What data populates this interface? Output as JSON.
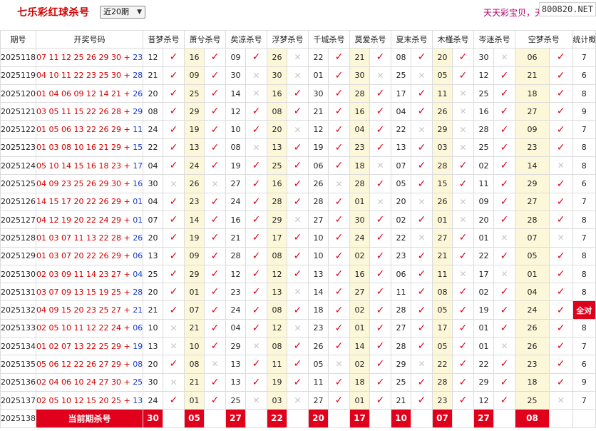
{
  "page_title": "七乐彩红球杀号",
  "period_select": {
    "value": "近20期",
    "arrow": "▼"
  },
  "slogan": "天天彩宝贝，天",
  "site_badge": "800820.NET",
  "headers": {
    "issue": "期号",
    "draw": "开奖号码",
    "experts": [
      "昔梦杀号",
      "萧兮杀号",
      "矣凉杀号",
      "浮梦杀号",
      "千城杀号",
      "莫爱杀号",
      "夏末杀号",
      "木槿杀号",
      "岑迷杀号",
      "空梦杀号"
    ],
    "stat": "统计概况"
  },
  "rows": [
    {
      "issue": "2025118",
      "draw": "07 11 12 25 26 29 30",
      "special": "23",
      "kills": [
        "12",
        "16",
        "09",
        "26",
        "22",
        "21",
        "08",
        "20",
        "30",
        "06"
      ],
      "hits": [
        true,
        true,
        true,
        false,
        true,
        true,
        true,
        true,
        false,
        true
      ],
      "stat": "7"
    },
    {
      "issue": "2025119",
      "draw": "04 10 11 22 23 25 30",
      "special": "28",
      "kills": [
        "21",
        "09",
        "30",
        "30",
        "01",
        "30",
        "25",
        "05",
        "12",
        "21"
      ],
      "hits": [
        true,
        true,
        false,
        false,
        true,
        false,
        false,
        true,
        true,
        true
      ],
      "stat": "6"
    },
    {
      "issue": "2025120",
      "draw": "01 04 06 09 12 14 21",
      "special": "26",
      "kills": [
        "20",
        "25",
        "14",
        "16",
        "30",
        "28",
        "17",
        "11",
        "25",
        "18"
      ],
      "hits": [
        true,
        true,
        false,
        true,
        true,
        true,
        true,
        false,
        true,
        true
      ],
      "stat": "8"
    },
    {
      "issue": "2025121",
      "draw": "03 05 11 15 22 26 28",
      "special": "29",
      "kills": [
        "08",
        "29",
        "12",
        "08",
        "21",
        "16",
        "04",
        "26",
        "16",
        "27"
      ],
      "hits": [
        true,
        true,
        true,
        true,
        true,
        true,
        true,
        false,
        true,
        true
      ],
      "stat": "9"
    },
    {
      "issue": "2025122",
      "draw": "01 05 06 13 22 26 29",
      "special": "11",
      "kills": [
        "24",
        "19",
        "10",
        "20",
        "12",
        "04",
        "22",
        "29",
        "28",
        "09"
      ],
      "hits": [
        true,
        true,
        true,
        false,
        true,
        true,
        false,
        false,
        true,
        true
      ],
      "stat": "7"
    },
    {
      "issue": "2025123",
      "draw": "01 03 08 10 16 21 29",
      "special": "15",
      "kills": [
        "22",
        "13",
        "08",
        "13",
        "19",
        "23",
        "13",
        "03",
        "25",
        "23"
      ],
      "hits": [
        true,
        true,
        false,
        true,
        true,
        true,
        true,
        false,
        true,
        true
      ],
      "stat": "8"
    },
    {
      "issue": "2025124",
      "draw": "05 10 14 15 16 18 23",
      "special": "17",
      "kills": [
        "04",
        "24",
        "19",
        "25",
        "06",
        "18",
        "07",
        "28",
        "02",
        "14"
      ],
      "hits": [
        true,
        true,
        true,
        true,
        true,
        false,
        true,
        true,
        true,
        false
      ],
      "stat": "8"
    },
    {
      "issue": "2025125",
      "draw": "04 09 23 25 26 29 30",
      "special": "16",
      "kills": [
        "30",
        "26",
        "27",
        "16",
        "26",
        "28",
        "05",
        "15",
        "11",
        "29"
      ],
      "hits": [
        false,
        false,
        true,
        true,
        false,
        true,
        true,
        true,
        true,
        true
      ],
      "stat": "6"
    },
    {
      "issue": "2025126",
      "draw": "14 15 17 20 22 26 29",
      "special": "01",
      "kills": [
        "04",
        "23",
        "24",
        "28",
        "28",
        "01",
        "20",
        "26",
        "09",
        "27"
      ],
      "hits": [
        true,
        true,
        true,
        true,
        true,
        false,
        false,
        false,
        true,
        true
      ],
      "stat": "7"
    },
    {
      "issue": "2025127",
      "draw": "04 12 19 20 22 24 29",
      "special": "01",
      "kills": [
        "07",
        "14",
        "16",
        "29",
        "27",
        "30",
        "02",
        "01",
        "20",
        "28"
      ],
      "hits": [
        true,
        true,
        true,
        false,
        true,
        true,
        true,
        false,
        true,
        true
      ],
      "stat": "8"
    },
    {
      "issue": "2025128",
      "draw": "01 03 07 11 13 22 28",
      "special": "26",
      "kills": [
        "20",
        "19",
        "21",
        "17",
        "10",
        "24",
        "22",
        "27",
        "01",
        "07"
      ],
      "hits": [
        true,
        true,
        true,
        true,
        true,
        true,
        false,
        true,
        false,
        false
      ],
      "stat": "7"
    },
    {
      "issue": "2025129",
      "draw": "01 03 07 20 22 26 29",
      "special": "06",
      "kills": [
        "13",
        "09",
        "28",
        "08",
        "10",
        "02",
        "23",
        "21",
        "22",
        "05"
      ],
      "hits": [
        true,
        true,
        true,
        true,
        true,
        true,
        true,
        true,
        true,
        true
      ],
      "stat": "8"
    },
    {
      "issue": "2025130",
      "draw": "02 03 09 11 14 23 27",
      "special": "04",
      "kills": [
        "25",
        "29",
        "12",
        "12",
        "13",
        "16",
        "06",
        "11",
        "17",
        "01"
      ],
      "hits": [
        true,
        true,
        true,
        true,
        true,
        true,
        true,
        false,
        false,
        true
      ],
      "stat": "8"
    },
    {
      "issue": "2025131",
      "draw": "03 07 09 13 15 19 25",
      "special": "28",
      "kills": [
        "20",
        "01",
        "23",
        "13",
        "14",
        "27",
        "11",
        "08",
        "02",
        "04"
      ],
      "hits": [
        true,
        true,
        true,
        false,
        true,
        true,
        true,
        true,
        true,
        true
      ],
      "stat": "8"
    },
    {
      "issue": "2025132",
      "draw": "04 09 15 20 23 25 27",
      "special": "21",
      "kills": [
        "21",
        "07",
        "24",
        "08",
        "18",
        "02",
        "28",
        "05",
        "19",
        "24"
      ],
      "hits": [
        true,
        true,
        true,
        true,
        true,
        true,
        true,
        true,
        true,
        true
      ],
      "stat": "全对",
      "stat_full": true
    },
    {
      "issue": "2025133",
      "draw": "02 05 10 11 12 22 24",
      "special": "06",
      "kills": [
        "10",
        "21",
        "04",
        "12",
        "23",
        "01",
        "27",
        "17",
        "01",
        "26"
      ],
      "hits": [
        false,
        true,
        true,
        false,
        true,
        true,
        true,
        true,
        true,
        true
      ],
      "stat": "8"
    },
    {
      "issue": "2025134",
      "draw": "01 02 07 13 22 25 29",
      "special": "19",
      "kills": [
        "13",
        "10",
        "29",
        "08",
        "26",
        "14",
        "28",
        "05",
        "01",
        "26"
      ],
      "hits": [
        false,
        true,
        false,
        true,
        true,
        true,
        true,
        true,
        false,
        true
      ],
      "stat": "7"
    },
    {
      "issue": "2025135",
      "draw": "05 06 12 22 26 27 29",
      "special": "08",
      "kills": [
        "20",
        "08",
        "13",
        "11",
        "05",
        "02",
        "29",
        "22",
        "22",
        "23"
      ],
      "hits": [
        true,
        false,
        true,
        true,
        false,
        true,
        false,
        true,
        true,
        true
      ],
      "stat": "6"
    },
    {
      "issue": "2025136",
      "draw": "02 04 06 10 24 27 30",
      "special": "25",
      "kills": [
        "30",
        "21",
        "13",
        "19",
        "11",
        "18",
        "25",
        "28",
        "29",
        "18"
      ],
      "hits": [
        false,
        true,
        true,
        true,
        true,
        true,
        true,
        true,
        true,
        true
      ],
      "stat": "9"
    },
    {
      "issue": "2025137",
      "draw": "02 05 10 12 15 20 25",
      "special": "13",
      "kills": [
        "24",
        "01",
        "25",
        "03",
        "27",
        "01",
        "21",
        "23",
        "12",
        "25"
      ],
      "hits": [
        true,
        true,
        false,
        false,
        true,
        true,
        true,
        true,
        true,
        false
      ],
      "stat": "7"
    }
  ],
  "current": {
    "issue": "2025138",
    "label": "当前期杀号",
    "kills": [
      "30",
      "05",
      "27",
      "22",
      "20",
      "17",
      "10",
      "07",
      "27",
      "08"
    ]
  },
  "symbols": {
    "hit": "✓",
    "miss": "✕"
  },
  "colors": {
    "accent": "#e0001b",
    "shade": "#fdf7d9",
    "blue": "#1a3cc8"
  }
}
